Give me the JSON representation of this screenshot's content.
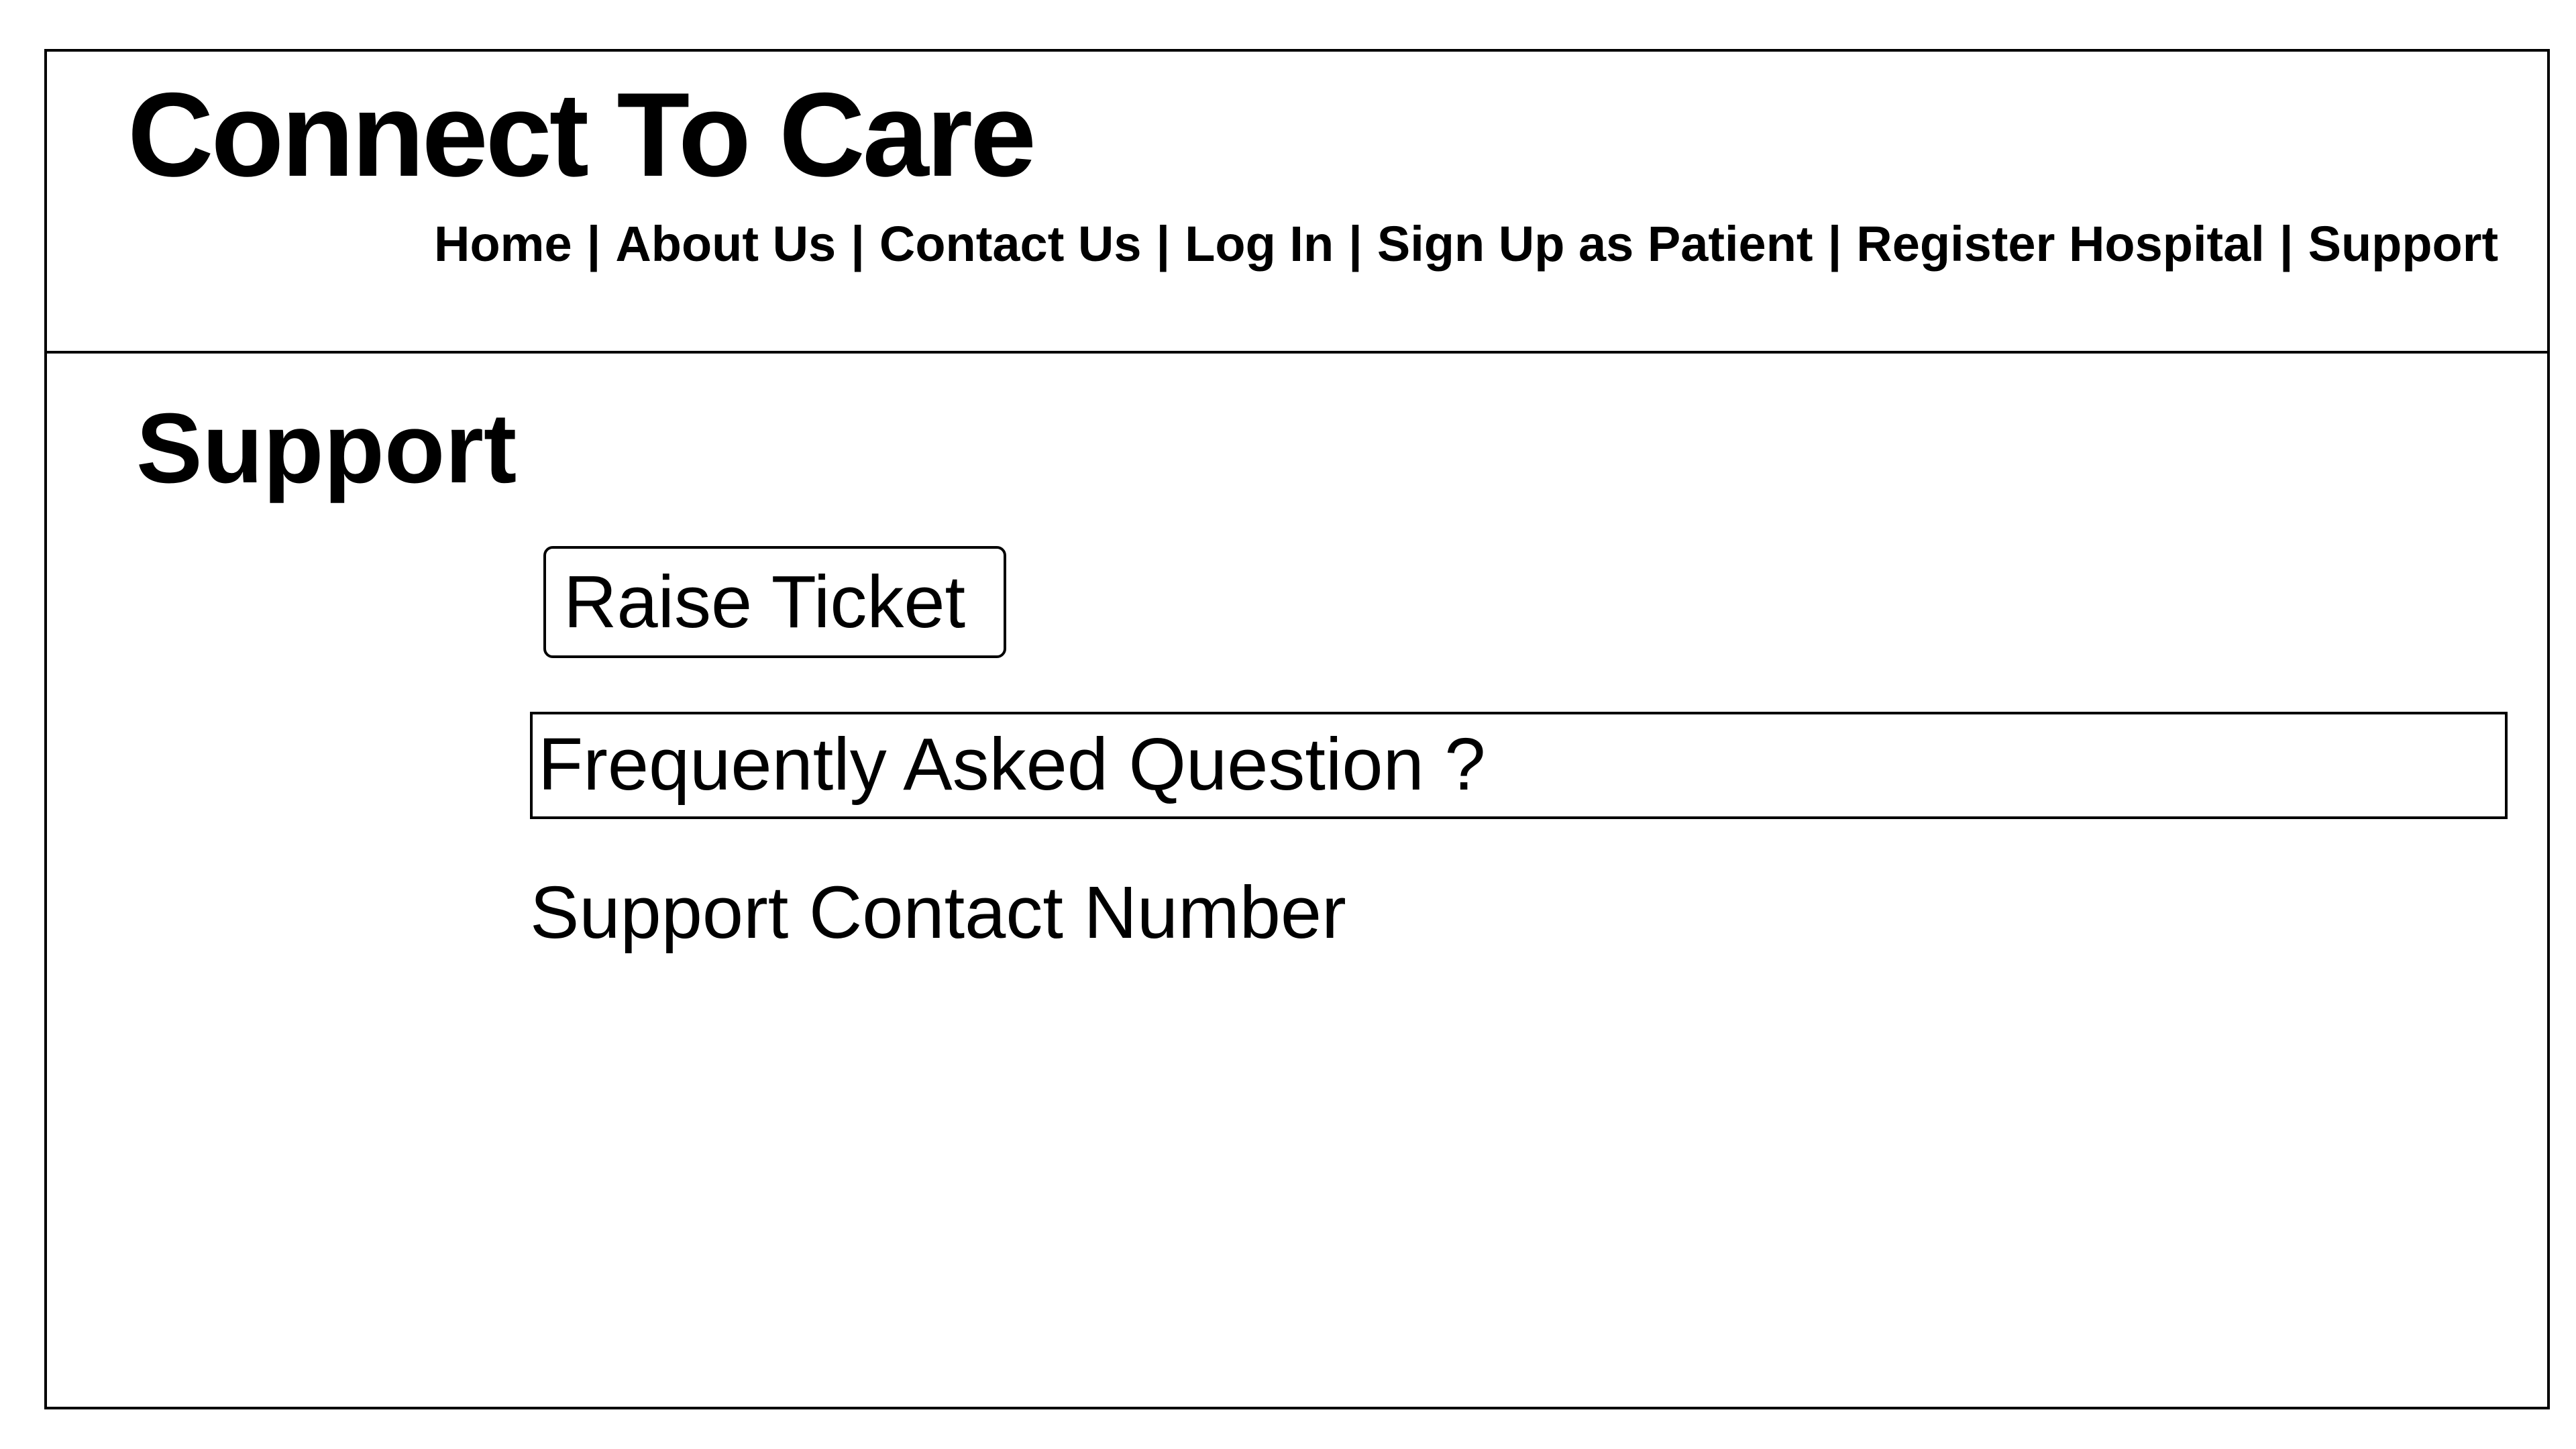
{
  "header": {
    "app_title": "Connect To Care",
    "nav": [
      {
        "label": "Home",
        "separator": "|"
      },
      {
        "label": "About Us",
        "separator": "|"
      },
      {
        "label": "Contact Us",
        "separator": "|"
      },
      {
        "label": "Log In",
        "separator": "|"
      },
      {
        "label": "Sign Up as Patient",
        "separator": "|"
      },
      {
        "label": "Register Hospital",
        "separator": "|"
      },
      {
        "label": "Support"
      }
    ]
  },
  "main": {
    "page_title": "Support",
    "raise_ticket_label": "Raise Ticket",
    "faq_label": "Frequently Asked Question ?",
    "support_contact_label": "Support Contact Number"
  },
  "colors": {
    "text": "#000000",
    "border": "#000000",
    "background": "#ffffff"
  }
}
